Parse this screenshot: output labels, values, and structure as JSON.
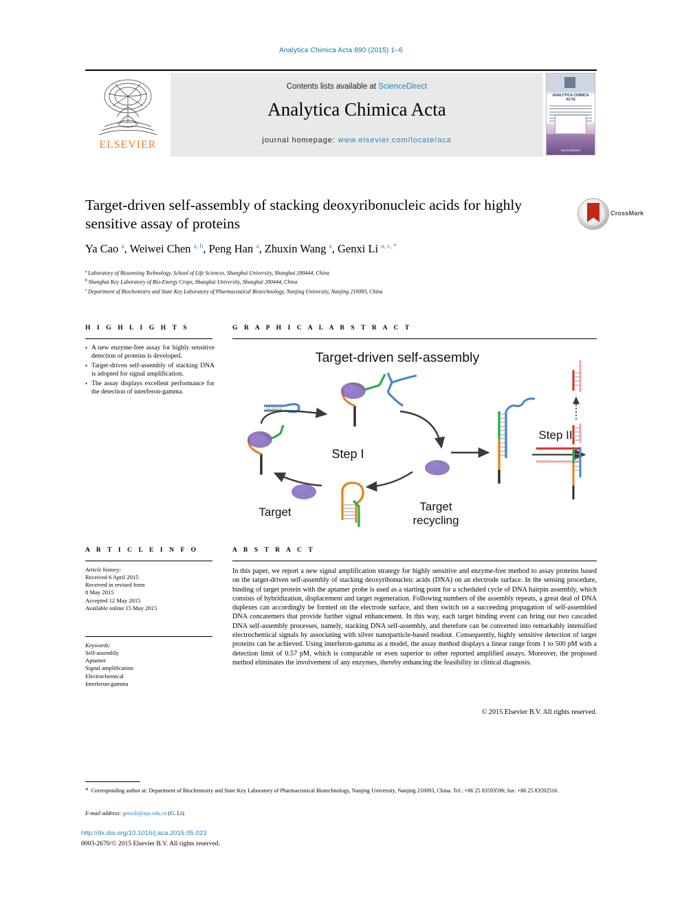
{
  "running_head": "Analytica Chimica Acta 890 (2015) 1–6",
  "masthead": {
    "contents_prefix": "Contents lists available at ",
    "contents_link": "ScienceDirect",
    "journal_name": "Analytica Chimica Acta",
    "homepage_label": "journal homepage: ",
    "homepage_url": "www.elsevier.com/locate/aca",
    "publisher": "ELSEVIER",
    "cover_title": "ANALYTICA CHIMICA ACTA",
    "cover_footer": "ScienceDirect"
  },
  "article": {
    "title": "Target-driven self-assembly of stacking deoxyribonucleic acids for highly sensitive assay of proteins",
    "crossmark_label": "CrossMark",
    "authors": [
      {
        "name": "Ya Cao",
        "marks": "a"
      },
      {
        "name": "Weiwei Chen",
        "marks": "a, b"
      },
      {
        "name": "Peng Han",
        "marks": "a"
      },
      {
        "name": "Zhuxin Wang",
        "marks": "a"
      },
      {
        "name": "Genxi Li",
        "marks": "a, c, *"
      }
    ],
    "affiliations": [
      {
        "mark": "a",
        "text": "Laboratory of Biosensing Technology, School of Life Sciences, Shanghai University, Shanghai 200444, China"
      },
      {
        "mark": "b",
        "text": "Shanghai Key Laboratory of Bio-Energy Crops, Shanghai University, Shanghai 200444, China"
      },
      {
        "mark": "c",
        "text": "Department of Biochemistry and State Key Laboratory of Pharmaceutical Biotechnology, Nanjing University, Nanjing 210093, China"
      }
    ]
  },
  "highlights": {
    "heading": "H I G H L I G H T S",
    "items": [
      "A new enzyme-free assay for highly sensitive detection of proteins is developed.",
      "Target-driven self-assembly of stacking DNA is adopted for signal amplification.",
      "The assay displays excellent performance for the detection of interferon-gamma."
    ]
  },
  "graphical_abstract": {
    "heading": "G R A P H I C A L   A B S T R A C T",
    "diagram_title": "Target-driven self-assembly",
    "labels": {
      "step1": "Step I",
      "step2": "Step II",
      "target": "Target",
      "recycling": "Target\nrecycling",
      "recycling_line1": "Target",
      "recycling_line2": "recycling"
    },
    "colors": {
      "target_protein": "#7a5fb5",
      "aptamer_orange": "#e8821e",
      "probe_blue": "#4a86c8",
      "green_strand": "#2eaa4a",
      "red_strand": "#e02a20",
      "dark_stem": "#2b2b2b",
      "arrow": "#3a3a3a"
    }
  },
  "article_info": {
    "heading": "A R T I C L E   I N F O",
    "history_label": "Article history:",
    "history": [
      "Received 6 April 2015",
      "Received in revised form",
      "8 May 2015",
      "Accepted 12 May 2015",
      "Available online 15 May 2015"
    ],
    "keywords_label": "Keywords:",
    "keywords": [
      "Self-assembly",
      "Aptamer",
      "Signal amplification",
      "Electrochemical",
      "Interferon-gamma"
    ]
  },
  "abstract": {
    "heading": "A B S T R A C T",
    "text": "In this paper, we report a new signal amplification strategy for highly sensitive and enzyme-free method to assay proteins based on the target-driven self-assembly of stacking deoxyribonucleic acids (DNA) on an electrode surface. In the sensing procedure, binding of target protein with the aptamer probe is used as a starting point for a scheduled cycle of DNA hairpin assembly, which consists of hybridization, displacement and target regeneration. Following numbers of the assembly repeats, a great deal of DNA duplexes can accordingly be formed on the electrode surface, and then switch on a succeeding propagation of self-assembled DNA concatemers that provide further signal enhancement. In this way, each target binding event can bring out two cascaded DNA self-assembly processes, namely, stacking DNA self-assembly, and therefore can be converted into remarkably intensified electrochemical signals by associating with silver nanoparticle-based readout. Consequently, highly sensitive detection of target proteins can be achieved. Using interferon-gamma as a model, the assay method displays a linear range from 1 to 500 pM with a detection limit of 0.57 pM, which is comparable or even superior to other reported amplified assays. Moreover, the proposed method eliminates the involvement of any enzymes, thereby enhancing the feasibility in clinical diagnosis.",
    "copyright": "© 2015 Elsevier B.V. All rights reserved."
  },
  "footer": {
    "corresponding": "Corresponding author at: Department of Biochemistry and State Key Laboratory of Pharmaceutical Biotechnology, Nanjing University, Nanjing 210093, China. Tel.: +86 25 83593596; fax: +86 25 83592510.",
    "email_label": "E-mail address:",
    "email": "genxili@nju.edu.cn",
    "email_owner": "(G. Li).",
    "doi": "http://dx.doi.org/10.1016/j.aca.2015.05.023",
    "issn": "0003-2670/© 2015 Elsevier B.V. All rights reserved."
  }
}
